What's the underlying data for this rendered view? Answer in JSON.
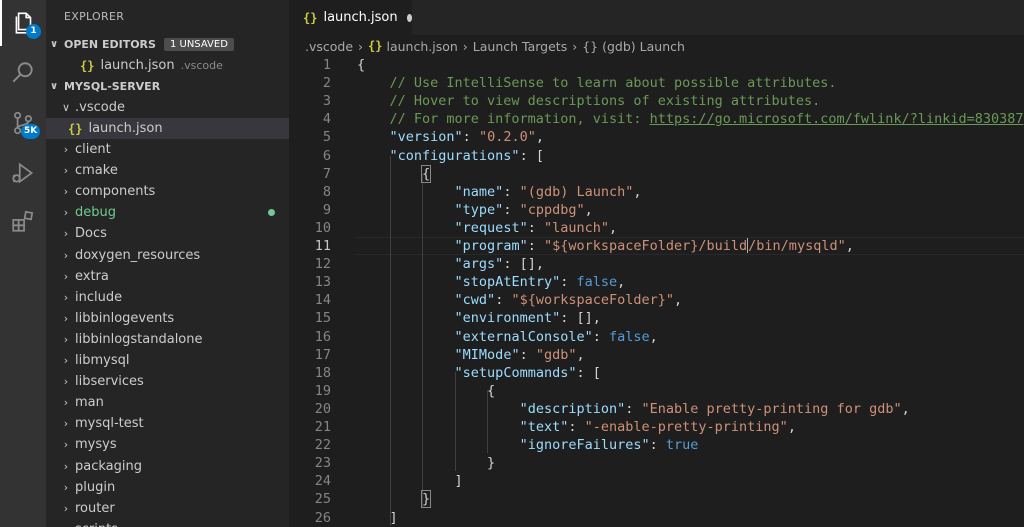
{
  "activity_bar": {
    "icons": [
      "files-icon",
      "search-icon",
      "source-control-icon",
      "run-debug-icon",
      "extensions-icon"
    ],
    "explorer_badge": "1",
    "source_control_badge": "5K",
    "accent_color": "#007acc"
  },
  "sidebar": {
    "title": "EXPLORER",
    "open_editors": {
      "label": "OPEN EDITORS",
      "badge": "1 UNSAVED",
      "files": [
        {
          "name": "launch.json",
          "folder": ".vscode"
        }
      ]
    },
    "project": {
      "label": "MYSQL-SERVER",
      "vscode_folder": ".vscode",
      "vscode_file": "launch.json",
      "folders": [
        "client",
        "cmake",
        "components",
        "debug",
        "Docs",
        "doxygen_resources",
        "extra",
        "include",
        "libbinlogevents",
        "libbinlogstandalone",
        "libmysql",
        "libservices",
        "man",
        "mysql-test",
        "mysys",
        "packaging",
        "plugin",
        "router",
        "scripts"
      ],
      "modified_folder": "debug",
      "modified_color": "#73c991"
    }
  },
  "editor": {
    "tab": {
      "label": "launch.json",
      "dirty": true
    },
    "breadcrumb": [
      ".vscode",
      "launch.json",
      "Launch Targets",
      "(gdb) Launch"
    ],
    "breadcrumb_symbol": "{}",
    "code_lines": [
      [
        [
          "p",
          "{"
        ]
      ],
      [
        [
          "cm",
          "    // Use IntelliSense to learn about possible attributes."
        ]
      ],
      [
        [
          "cm",
          "    // Hover to view descriptions of existing attributes."
        ]
      ],
      [
        [
          "cm",
          "    // For more information, visit: "
        ],
        [
          "link",
          "https://go.microsoft.com/fwlink/?linkid=830387"
        ]
      ],
      [
        [
          "p",
          "    "
        ],
        [
          "key",
          "\"version\""
        ],
        [
          "p",
          ": "
        ],
        [
          "str",
          "\"0.2.0\""
        ],
        [
          "p",
          ","
        ]
      ],
      [
        [
          "p",
          "    "
        ],
        [
          "key",
          "\"configurations\""
        ],
        [
          "p",
          ": ["
        ]
      ],
      [
        [
          "p",
          "        "
        ],
        [
          "hl",
          "{"
        ]
      ],
      [
        [
          "p",
          "            "
        ],
        [
          "key",
          "\"name\""
        ],
        [
          "p",
          ": "
        ],
        [
          "str",
          "\"(gdb) Launch\""
        ],
        [
          "p",
          ","
        ]
      ],
      [
        [
          "p",
          "            "
        ],
        [
          "key",
          "\"type\""
        ],
        [
          "p",
          ": "
        ],
        [
          "str",
          "\"cppdbg\""
        ],
        [
          "p",
          ","
        ]
      ],
      [
        [
          "p",
          "            "
        ],
        [
          "key",
          "\"request\""
        ],
        [
          "p",
          ": "
        ],
        [
          "str",
          "\"launch\""
        ],
        [
          "p",
          ","
        ]
      ],
      [
        [
          "p",
          "            "
        ],
        [
          "key",
          "\"program\""
        ],
        [
          "p",
          ": "
        ],
        [
          "str",
          "\"${workspaceFolder}/build"
        ],
        [
          "caret",
          ""
        ],
        [
          "str",
          "/bin/mysqld\""
        ],
        [
          "p",
          ","
        ]
      ],
      [
        [
          "p",
          "            "
        ],
        [
          "key",
          "\"args\""
        ],
        [
          "p",
          ": [],"
        ]
      ],
      [
        [
          "p",
          "            "
        ],
        [
          "key",
          "\"stopAtEntry\""
        ],
        [
          "p",
          ": "
        ],
        [
          "kw",
          "false"
        ],
        [
          "p",
          ","
        ]
      ],
      [
        [
          "p",
          "            "
        ],
        [
          "key",
          "\"cwd\""
        ],
        [
          "p",
          ": "
        ],
        [
          "str",
          "\"${workspaceFolder}\""
        ],
        [
          "p",
          ","
        ]
      ],
      [
        [
          "p",
          "            "
        ],
        [
          "key",
          "\"environment\""
        ],
        [
          "p",
          ": [],"
        ]
      ],
      [
        [
          "p",
          "            "
        ],
        [
          "key",
          "\"externalConsole\""
        ],
        [
          "p",
          ": "
        ],
        [
          "kw",
          "false"
        ],
        [
          "p",
          ","
        ]
      ],
      [
        [
          "p",
          "            "
        ],
        [
          "key",
          "\"MIMode\""
        ],
        [
          "p",
          ": "
        ],
        [
          "str",
          "\"gdb\""
        ],
        [
          "p",
          ","
        ]
      ],
      [
        [
          "p",
          "            "
        ],
        [
          "key",
          "\"setupCommands\""
        ],
        [
          "p",
          ": ["
        ]
      ],
      [
        [
          "p",
          "                {"
        ]
      ],
      [
        [
          "p",
          "                    "
        ],
        [
          "key",
          "\"description\""
        ],
        [
          "p",
          ": "
        ],
        [
          "str",
          "\"Enable pretty-printing for gdb\""
        ],
        [
          "p",
          ","
        ]
      ],
      [
        [
          "p",
          "                    "
        ],
        [
          "key",
          "\"text\""
        ],
        [
          "p",
          ": "
        ],
        [
          "str",
          "\"-enable-pretty-printing\""
        ],
        [
          "p",
          ","
        ]
      ],
      [
        [
          "p",
          "                    "
        ],
        [
          "key",
          "\"ignoreFailures\""
        ],
        [
          "p",
          ": "
        ],
        [
          "kw",
          "true"
        ]
      ],
      [
        [
          "p",
          "                }"
        ]
      ],
      [
        [
          "p",
          "            ]"
        ]
      ],
      [
        [
          "p",
          "        "
        ],
        [
          "hl",
          "}"
        ]
      ],
      [
        [
          "p",
          "    ]"
        ]
      ]
    ],
    "current_line": 11
  }
}
